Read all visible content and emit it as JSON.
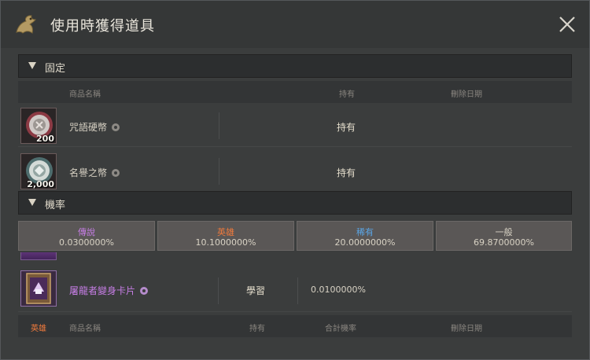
{
  "window": {
    "title": "使用時獲得道具",
    "colors": {
      "hero": "#f07a3c",
      "legend": "#c77ee6",
      "rare": "#5aa6e6",
      "normal": "#d8d2c4"
    }
  },
  "fixed": {
    "section_label": "固定",
    "columns": {
      "name": "商品名稱",
      "owned": "持有",
      "delete_date": "刪除日期"
    },
    "items": [
      {
        "name": "咒語硬幣",
        "qty": "200",
        "owned": "持有",
        "icon": "coin-red-icon"
      },
      {
        "name": "名譽之幣",
        "qty": "2,000",
        "owned": "持有",
        "icon": "coin-teal-icon"
      }
    ]
  },
  "rate": {
    "section_label": "機率",
    "grades": [
      {
        "grade": "傳說",
        "pct": "0.0300000%",
        "color": "#c77ee6"
      },
      {
        "grade": "英雄",
        "pct": "10.1000000%",
        "color": "#f07a3c"
      },
      {
        "grade": "稀有",
        "pct": "20.0000000%",
        "color": "#5aa6e6"
      },
      {
        "grade": "一般",
        "pct": "69.8700000%",
        "color": "#d8d2c4"
      }
    ],
    "items": [
      {
        "name": "屠龍者變身卡片",
        "status": "學習",
        "rate": "0.0100000%",
        "icon": "card-icon"
      }
    ],
    "bottom_columns": {
      "grade": "英雄",
      "name": "商品名稱",
      "owned": "持有",
      "total_rate": "合計機率",
      "delete_date": "刪除日期"
    }
  }
}
